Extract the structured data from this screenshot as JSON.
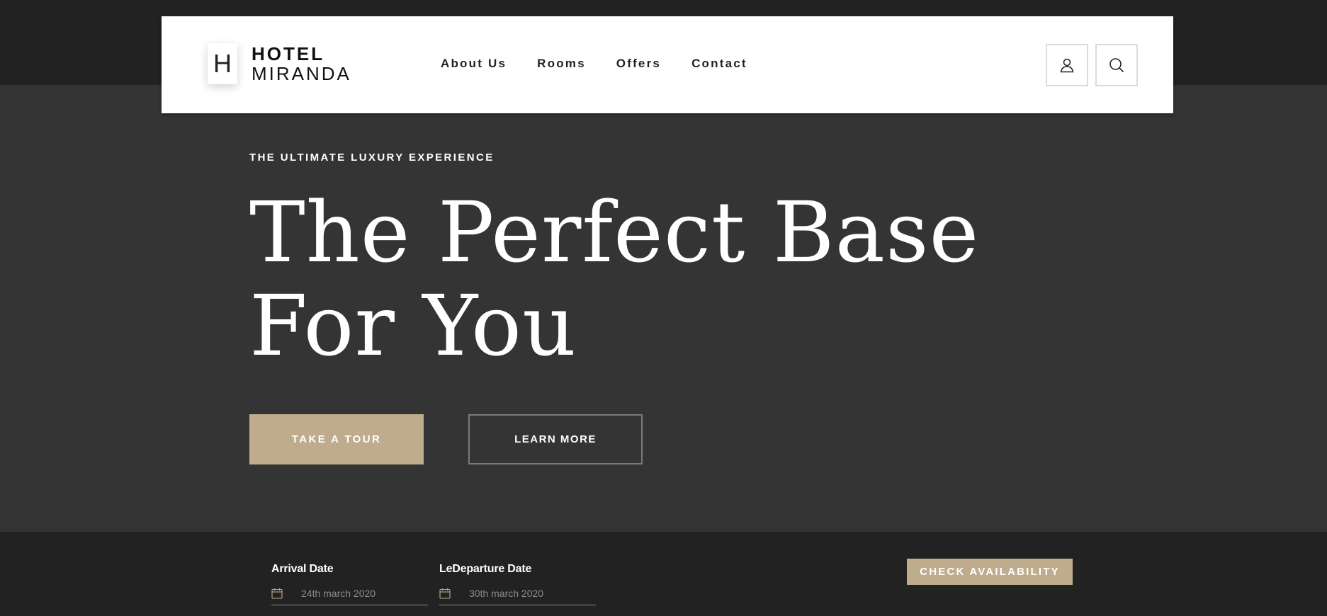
{
  "header": {
    "logo_mark": "H",
    "logo_line1": "HOTEL",
    "logo_line2": "MIRANDA",
    "nav": [
      {
        "label": "About Us"
      },
      {
        "label": "Rooms"
      },
      {
        "label": "Offers"
      },
      {
        "label": "Contact"
      }
    ],
    "icons": {
      "account": "user-icon",
      "search": "search-icon"
    }
  },
  "hero": {
    "eyebrow": "THE ULTIMATE LUXURY EXPERIENCE",
    "title": "The Perfect Base For You",
    "primary_button": "TAKE A TOUR",
    "secondary_button": "LEARN MORE"
  },
  "booking": {
    "arrival_label": "Arrival Date",
    "arrival_placeholder": "24th march 2020",
    "departure_label": "LeDeparture Date",
    "departure_placeholder": "30th march 2020",
    "check_button": "CHECK AVAILABILITY"
  },
  "colors": {
    "accent": "#bfac8d",
    "dark_band": "#222222",
    "hero_bg": "#343434",
    "header_bg": "#ffffff"
  }
}
